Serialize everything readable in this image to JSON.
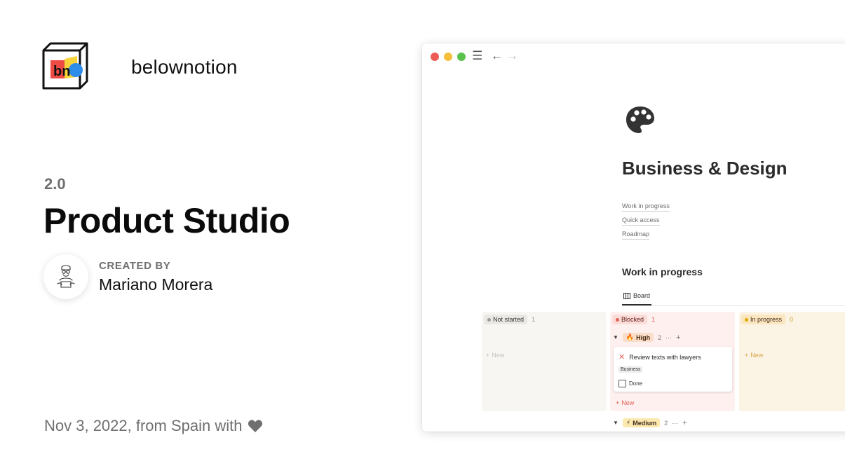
{
  "brand": {
    "logo_text": "bn",
    "name": "belownotion"
  },
  "hero": {
    "version": "2.0",
    "title": "Product Studio",
    "created_by_label": "CREATED BY",
    "author": "Mariano Morera"
  },
  "footer": {
    "text": "Nov 3, 2022, from Spain with",
    "heart_icon": "heart-icon"
  },
  "window": {
    "toolbar_icons": [
      "close-dot",
      "minimize-dot",
      "maximize-dot",
      "menu-icon",
      "back-arrow-icon",
      "forward-arrow-icon"
    ],
    "page": {
      "icon": "palette-icon",
      "title": "Business & Design",
      "toc": [
        "Work in progress",
        "Quick access",
        "Roadmap"
      ],
      "section_title": "Work in progress",
      "view_tab": "Board"
    },
    "board": {
      "columns": [
        {
          "label": "Not started",
          "count": "1",
          "color": "#9b9a97"
        },
        {
          "label": "Blocked",
          "count": "1",
          "color": "#e16259"
        },
        {
          "label": "In progress",
          "count": "0",
          "color": "#dfab01"
        }
      ],
      "groups": [
        {
          "label": "High",
          "count": "2",
          "icon": "fire-icon"
        },
        {
          "label": "Medium",
          "count": "2",
          "icon": "lightning-icon"
        }
      ],
      "card": {
        "title": "Review texts with lawyers",
        "tag": "Business",
        "checkbox_label": "Done"
      },
      "new_label": "New",
      "more": "···",
      "plus": "+"
    }
  },
  "colors": {
    "title": "#0b0b0b",
    "muted": "#6f6f6f",
    "blocked_bg": "#fdf0ee",
    "in_progress_bg": "#fbf3e4",
    "not_started_bg": "#f7f6f3"
  }
}
